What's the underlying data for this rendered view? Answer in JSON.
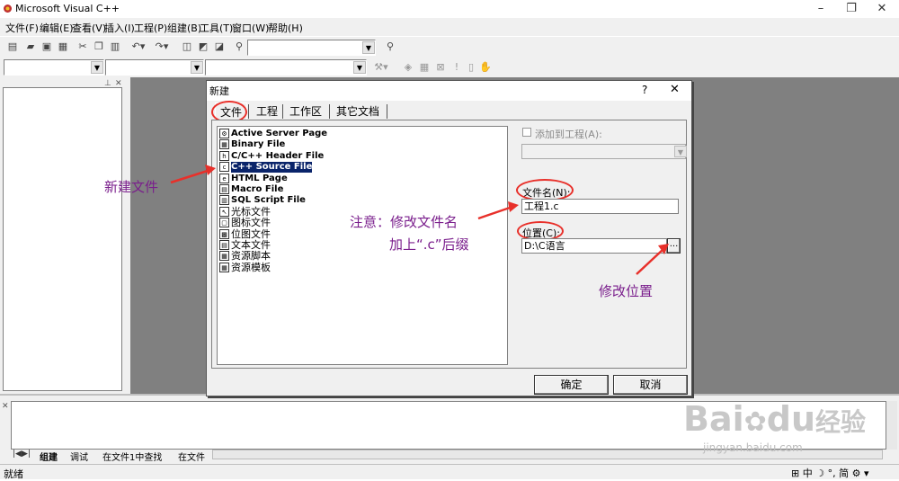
{
  "window": {
    "title": "Microsoft Visual C++",
    "minimize": "–",
    "maximize": "❐",
    "close": "✕"
  },
  "menu": [
    "文件(F)",
    "编辑(E)",
    "查看(V)",
    "插入(I)",
    "工程(P)",
    "组建(B)",
    "工具(T)",
    "窗口(W)",
    "帮助(H)"
  ],
  "dialog": {
    "title": "新建",
    "help": "?",
    "close": "✕",
    "tabs": [
      "文件",
      "工程",
      "工作区",
      "其它文档"
    ],
    "file_types": [
      "Active Server Page",
      "Binary File",
      "C/C++ Header File",
      "C++ Source File",
      "HTML Page",
      "Macro File",
      "SQL Script File",
      "光标文件",
      "图标文件",
      "位图文件",
      "文本文件",
      "资源脚本",
      "资源模板"
    ],
    "selected_index": 3,
    "add_to_project_label": "添加到工程(A):",
    "filename_label": "文件名(N):",
    "filename_value": "工程1.c",
    "location_label": "位置(C):",
    "location_value": "D:\\C语言",
    "browse_label": "...",
    "ok_label": "确定",
    "cancel_label": "取消"
  },
  "annotations": {
    "new_file": "新建文件",
    "note_line1": "注意：修改文件名",
    "note_line2": "加上“.c”后缀",
    "change_location": "修改位置"
  },
  "output_tabs": [
    "组建",
    "调试",
    "在文件1中查找",
    "在文件"
  ],
  "status": {
    "text": "就绪",
    "ime": "中",
    "ime_mode": "简"
  },
  "watermark": {
    "brand": "Bai",
    "brand2": "du",
    "brand_cn": "经验",
    "url": "jingyan.baidu.com"
  },
  "colors": {
    "accent_red": "#e8302a",
    "annotation_purple": "#7a1e8c",
    "selection": "#0a246a"
  }
}
